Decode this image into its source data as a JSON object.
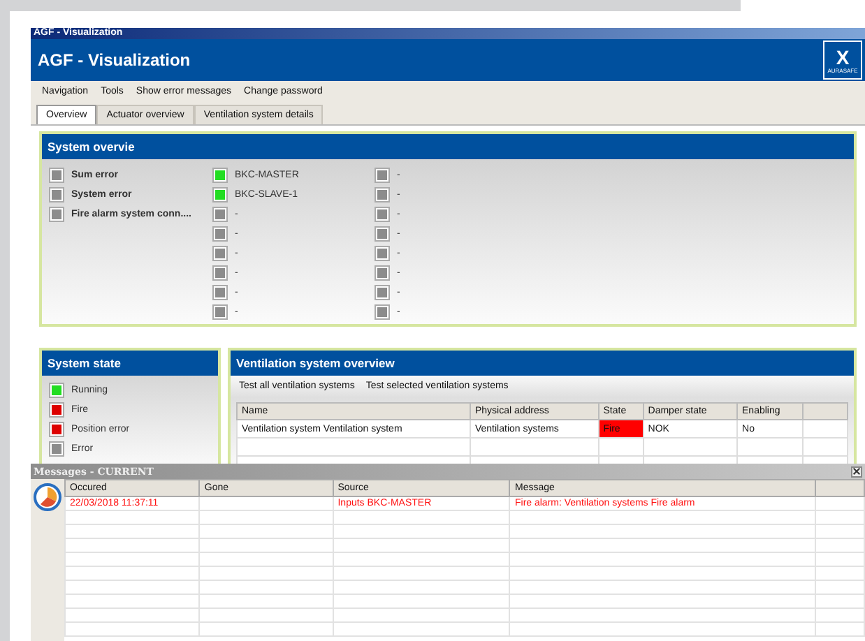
{
  "window": {
    "caption": "AGF - Visualization",
    "title": "AGF - Visualization",
    "logo": {
      "mark": "X",
      "text": "AURASAFE"
    }
  },
  "menu": [
    "Navigation",
    "Tools",
    "Show error messages",
    "Change password"
  ],
  "tabs": [
    {
      "label": "Overview",
      "selected": true
    },
    {
      "label": "Actuator overview",
      "selected": false
    },
    {
      "label": "Ventilation system details",
      "selected": false
    }
  ],
  "system_overview": {
    "title": "System overvie",
    "columns": [
      [
        {
          "label": "Sum error",
          "color": "#8c8c8c"
        },
        {
          "label": "System error",
          "color": "#8c8c8c"
        },
        {
          "label": "Fire alarm system conn....",
          "color": "#8c8c8c"
        }
      ],
      [
        {
          "label": "BKC-MASTER",
          "color": "#22dd22"
        },
        {
          "label": "BKC-SLAVE-1",
          "color": "#22dd22"
        },
        {
          "label": "-",
          "color": "#8c8c8c"
        },
        {
          "label": "-",
          "color": "#8c8c8c"
        },
        {
          "label": "-",
          "color": "#8c8c8c"
        },
        {
          "label": "-",
          "color": "#8c8c8c"
        },
        {
          "label": "-",
          "color": "#8c8c8c"
        },
        {
          "label": "-",
          "color": "#8c8c8c"
        }
      ],
      [
        {
          "label": "-",
          "color": "#8c8c8c"
        },
        {
          "label": "-",
          "color": "#8c8c8c"
        },
        {
          "label": "-",
          "color": "#8c8c8c"
        },
        {
          "label": "-",
          "color": "#8c8c8c"
        },
        {
          "label": "-",
          "color": "#8c8c8c"
        },
        {
          "label": "-",
          "color": "#8c8c8c"
        },
        {
          "label": "-",
          "color": "#8c8c8c"
        },
        {
          "label": "-",
          "color": "#8c8c8c"
        }
      ]
    ]
  },
  "system_state": {
    "title": "System state",
    "items": [
      {
        "label": "Running",
        "color": "#22dd22"
      },
      {
        "label": "Fire",
        "color": "#dd0000"
      },
      {
        "label": "Position error",
        "color": "#dd0000"
      },
      {
        "label": "Error",
        "color": "#8c8c8c"
      }
    ]
  },
  "ventilation_overview": {
    "title": "Ventilation system overview",
    "buttons": [
      "Test all ventilation systems",
      "Test selected ventilation systems"
    ],
    "columns": [
      "Name",
      "Physical address",
      "State",
      "Damper state",
      "Enabling"
    ],
    "rows": [
      {
        "cells": [
          "Ventilation system Ventilation system",
          "Ventilation systems",
          "Fire",
          "NOK",
          "No"
        ],
        "alarm": true
      }
    ]
  },
  "messages": {
    "title": "Messages - CURRENT",
    "columns": [
      "Occured",
      "Gone",
      "Source",
      "Message"
    ],
    "rows": [
      {
        "cells": [
          "22/03/2018 11:37:11",
          "",
          "Inputs BKC-MASTER",
          "Fire alarm: Ventilation systems Fire alarm"
        ],
        "alarm": true
      }
    ]
  }
}
